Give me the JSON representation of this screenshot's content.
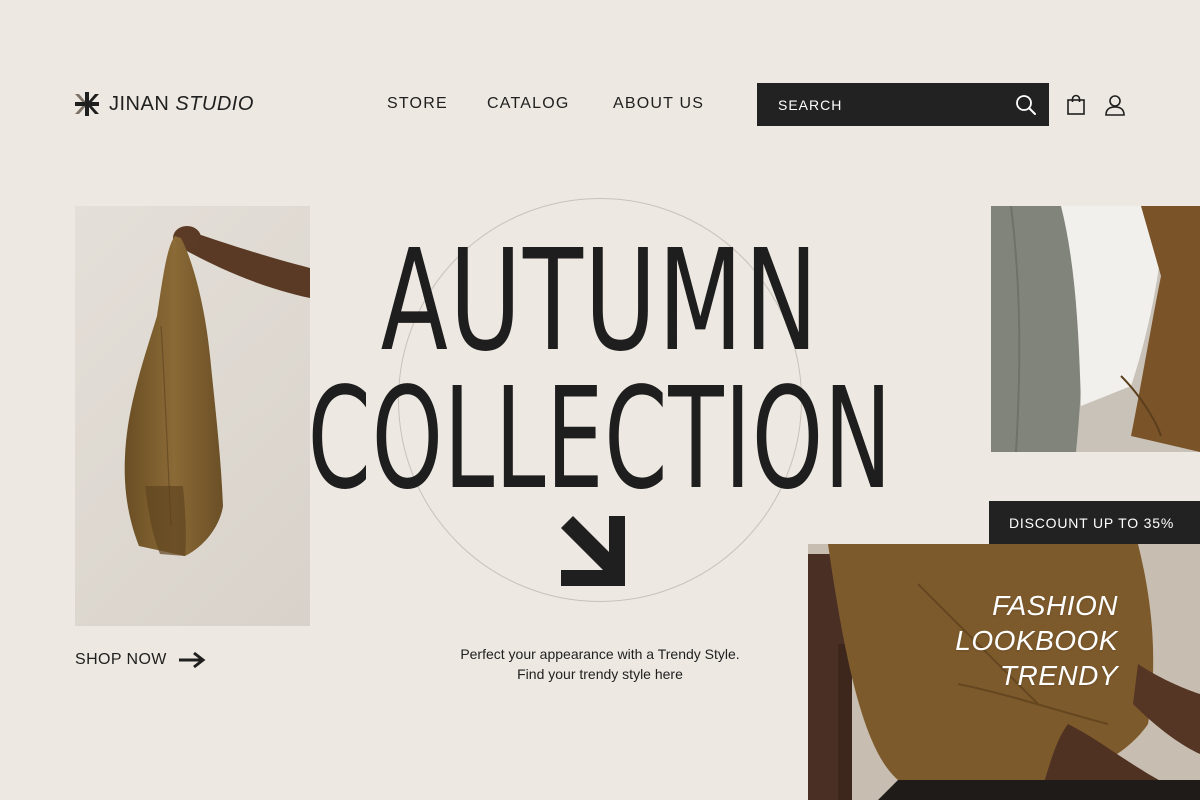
{
  "brand": {
    "name_regular": "JINAN",
    "name_italic": "STUDIO"
  },
  "nav": {
    "items": [
      {
        "label": "STORE"
      },
      {
        "label": "CATALOG"
      },
      {
        "label": "ABOUT US"
      }
    ]
  },
  "search": {
    "placeholder": "SEARCH",
    "icon": "search-icon"
  },
  "header_icons": [
    "shopping-bag-icon",
    "user-icon"
  ],
  "hero": {
    "title_line1": "AUTUMN",
    "title_line2": "COLLECTION",
    "tagline_line1": "Perfect your appearance with a Trendy Style.",
    "tagline_line2": "Find your trendy style here"
  },
  "cta": {
    "shop_now": "SHOP NOW",
    "icon": "arrow-right-icon"
  },
  "discount": {
    "label": "DISCOUNT UP TO 35%"
  },
  "lookbook": {
    "line1": "FASHION",
    "line2": "LOOKBOOK",
    "line3": "TRENDY"
  },
  "colors": {
    "background": "#ede8e1",
    "dark": "#222222",
    "accent_brown": "#7a5a2a"
  }
}
